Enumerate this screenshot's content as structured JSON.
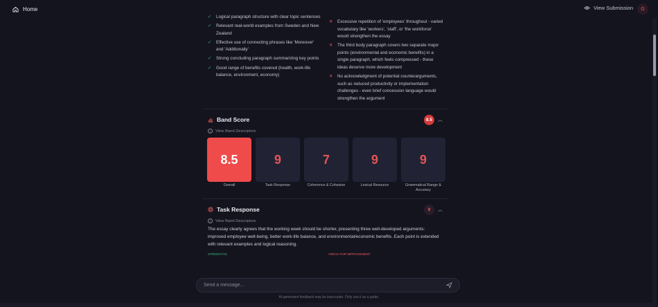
{
  "topbar": {
    "home_label": "Home",
    "view_submission_label": "View Submission",
    "avatar_initial": "G"
  },
  "feedback": {
    "strengths": [
      "Logical paragraph structure with clear topic sentences",
      "Relevant real-world examples from Sweden and New Zealand",
      "Effective use of connecting phrases like 'Moreover' and 'Additionally'",
      "Strong concluding paragraph summarizing key points",
      "Good range of benefits covered (health, work-life balance, environment, economy)"
    ],
    "weaknesses": [
      "Excessive repetition of 'employees' throughout - varied vocabulary like 'workers', 'staff', or 'the workforce' would strengthen the essay",
      "The third body paragraph covers two separate major points (environmental and economic benefits) in a single paragraph, which feels compressed - these ideas deserve more development",
      "No acknowledgment of potential counterarguments, such as reduced productivity or implementation challenges - even brief concession language would strengthen the argument"
    ]
  },
  "band_score": {
    "title": "Band Score",
    "score": "8.5",
    "descriptors_link": "View Band Descriptors",
    "tiles": [
      {
        "value": "8.5",
        "label": "Overall",
        "active": true
      },
      {
        "value": "9",
        "label": "Task Response",
        "active": false
      },
      {
        "value": "7",
        "label": "Coherence & Cohesion",
        "active": false
      },
      {
        "value": "9",
        "label": "Lexical Resource",
        "active": false
      },
      {
        "value": "9",
        "label": "Grammatical Range & Accuracy",
        "active": false
      }
    ]
  },
  "task_response": {
    "title": "Task Response",
    "score": "9",
    "descriptors_link": "View Band Descriptors",
    "text": "The essay clearly agrees that the working week should be shorter, presenting three well-developed arguments: improved employee well-being, better work-life balance, and environmental/economic benefits. Each point is extended with relevant examples and logical reasoning.",
    "strengths_heading": "STRENGTHS",
    "improvements_heading": "AREAS FOR IMPROVEMENT"
  },
  "message_bar": {
    "placeholder": "Send a message...",
    "disclaimer": "AI-generated feedback may be inaccurate. Only use it as a guide."
  },
  "colors": {
    "accent": "#ef4b4b",
    "success": "#3bb87a",
    "background": "#14141f"
  }
}
